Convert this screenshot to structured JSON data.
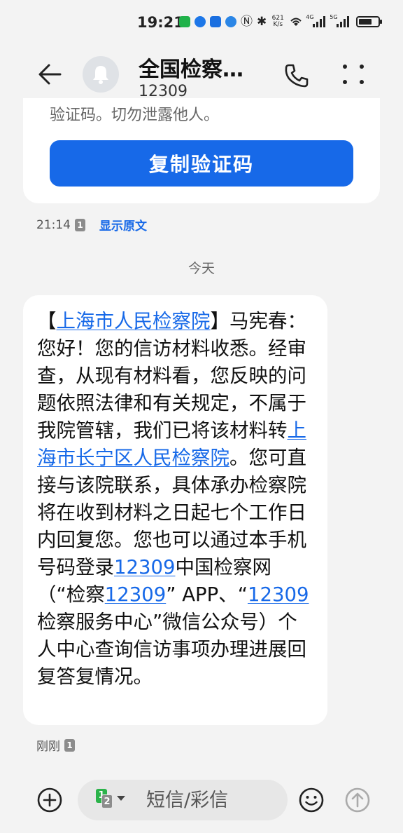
{
  "status_bar": {
    "time": "19:21",
    "net_speed_value": "621",
    "net_speed_unit": "K/s",
    "signal_1_tag": "4G",
    "signal_2_tag": "5G"
  },
  "header": {
    "contact_name": "全国检察…",
    "contact_number": "12309"
  },
  "previous_message": {
    "cut_text": "验证码。切勿泄露他人。",
    "copy_button_label": "复制验证码",
    "time": "21:14",
    "sim_badge": "1",
    "show_original_label": "显示原文"
  },
  "date_divider": "今天",
  "message": {
    "p1": "【",
    "link1": "上海市人民检察院",
    "p2": "】马宪春：您好！您的信访材料收悉。经审查，从现有材料看，您反映的问题依照法律和有关规定，不属于我院管辖，我们已将该材料转",
    "link2": "上海市长宁区人民检察院",
    "p3": "。您可直接与该院联系，具体承办检察院将在收到材料之日起七个工作日内回复您。您也可以通过本手机号码登录",
    "link3": "12309",
    "p4": "中国检察网（“检察",
    "link4": "12309",
    "p5": "” APP、“",
    "link5": "12309",
    "p6": "检察服务中心”微信公众号）个人中心查询信访事项办理进展回复答复情况。",
    "time": "刚刚",
    "sim_badge": "1"
  },
  "input_bar": {
    "sim_primary": "1",
    "sim_secondary": "2",
    "placeholder": "短信/彩信"
  },
  "colors": {
    "accent": "#1769e8",
    "background": "#f3f3f3",
    "bubble": "#ffffff"
  }
}
